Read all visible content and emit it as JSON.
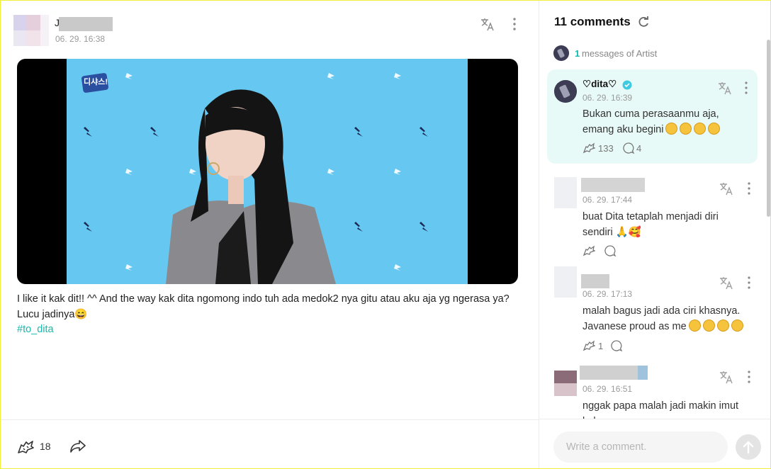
{
  "post": {
    "author_name": "J",
    "timestamp": "06. 29. 16:38",
    "text": "I like it kak dit!! ^^ And the way kak dita ngomong indo tuh ada medok2 nya gitu atau aku aja yg ngerasa ya? Lucu jadinya😄",
    "hashtag": "#to_dita",
    "video_logo": "디샤스!",
    "cheer_count": "18"
  },
  "comments_panel": {
    "title": "11 comments",
    "artist_count": "1",
    "artist_label": "messages of Artist",
    "composer_placeholder": "Write a comment.",
    "items": [
      {
        "name": "♡dita♡",
        "verified": true,
        "time": "06. 29. 16:39",
        "text": "Bukan cuma perasaanmu aja, emang aku begini",
        "cheers": "133",
        "replies": "4"
      },
      {
        "name": "",
        "time": "06. 29. 17:44",
        "text": "buat Dita tetaplah menjadi diri sendiri 🙏🥰",
        "cheers": "",
        "replies": ""
      },
      {
        "name": "",
        "time": "06. 29. 17:13",
        "text": "malah bagus jadi ada ciri khasnya. Javanese proud as me",
        "cheers": "1",
        "replies": ""
      },
      {
        "name": "",
        "time": "06. 29. 16:51",
        "text": "nggak papa malah jadi makin imut kak"
      }
    ]
  },
  "colors": {
    "accent": "#17b8ad",
    "artist_bg": "#e7faf7",
    "video_bg": "#66c7f0"
  }
}
